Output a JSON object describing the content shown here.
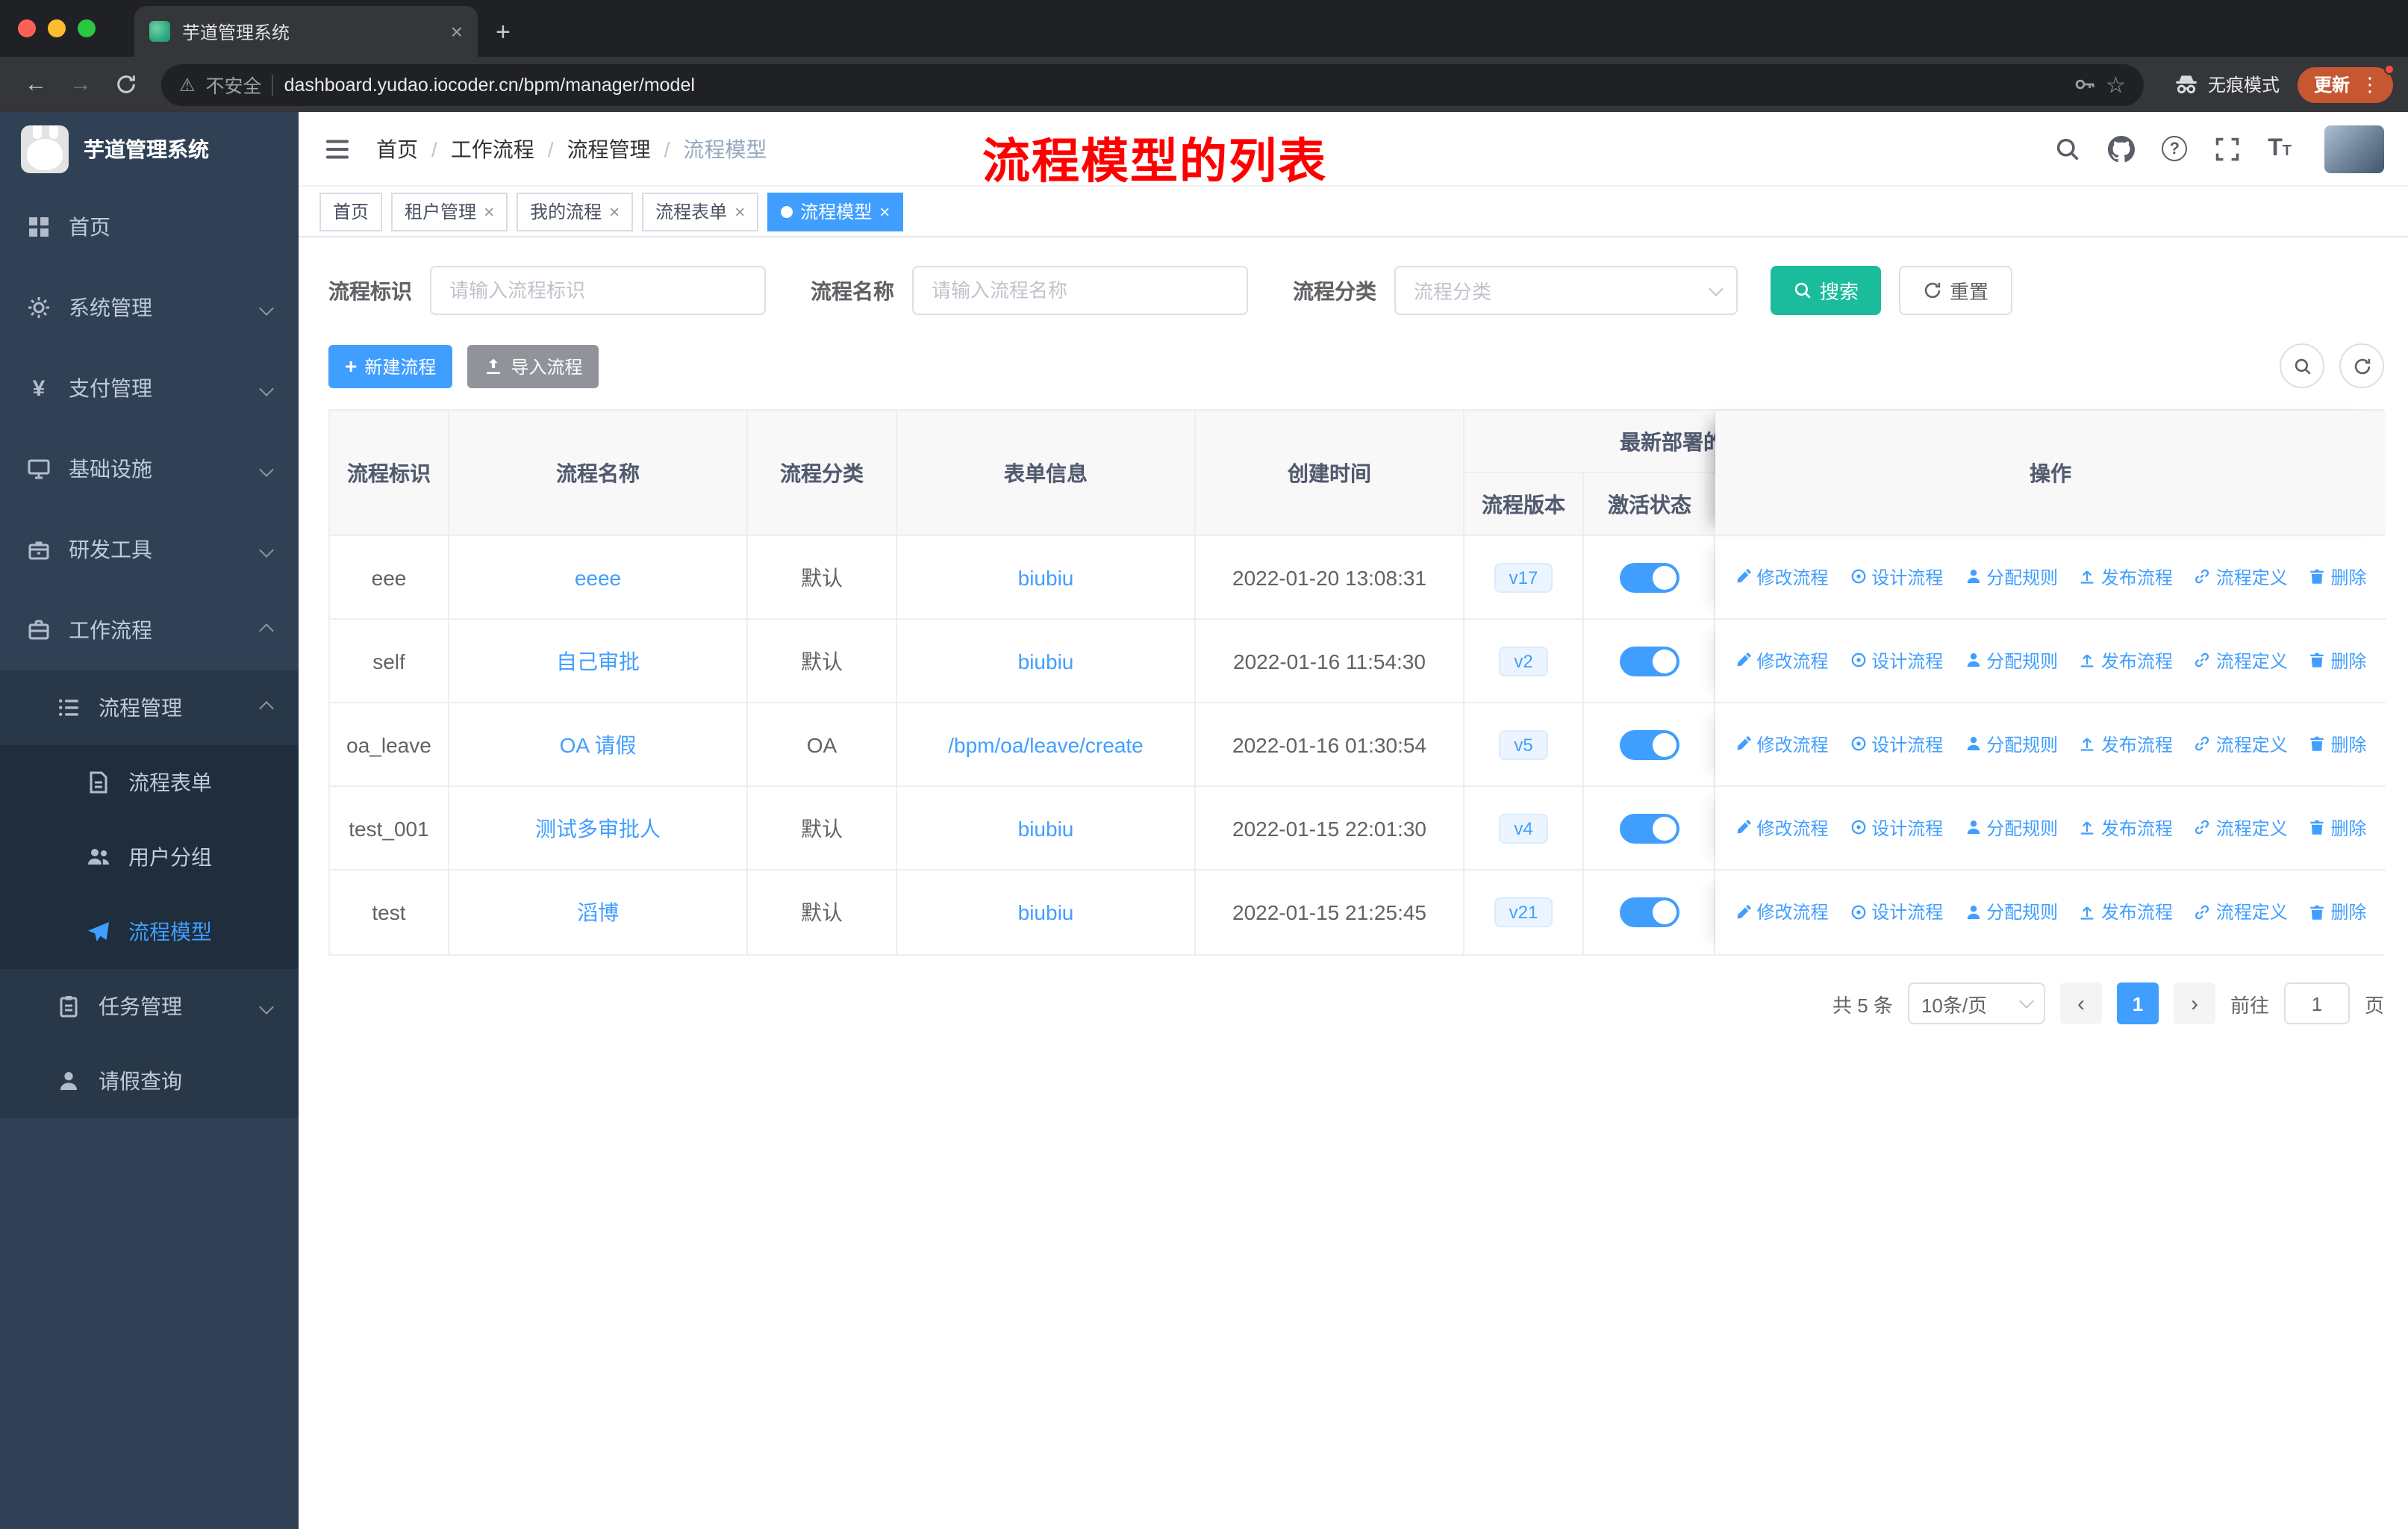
{
  "colors": {
    "primary": "#409EFF",
    "search_button": "#1ABC9C",
    "sidebar_bg": "#304156",
    "active_tag": "#409EFF",
    "annotation_red": "#FF0000",
    "toggle_on": "#409EFF",
    "update_pill": "#C65730"
  },
  "glyphs": {
    "back_arrow": "←",
    "forward_arrow": "→",
    "warning": "⚠",
    "star": "☆",
    "menu_dots": "⋮",
    "close": "×",
    "new_tab": "+",
    "plus": "+",
    "yen": "¥",
    "question": "?",
    "font_size_big": "T",
    "font_size_small": "T",
    "slash": "/",
    "prev": "‹",
    "next": "›"
  },
  "browser": {
    "tab_title": "芋道管理系统",
    "security_label": "不安全",
    "url": "dashboard.yudao.iocoder.cn/bpm/manager/model",
    "incognito_label": "无痕模式",
    "update_label": "更新"
  },
  "sidebar": {
    "logo_title": "芋道管理系统",
    "items": {
      "home": "首页",
      "system": "系统管理",
      "payment": "支付管理",
      "infrastructure": "基础设施",
      "devtools": "研发工具",
      "workflow": "工作流程",
      "process_mgmt": "流程管理",
      "process_form": "流程表单",
      "user_group": "用户分组",
      "process_model": "流程模型",
      "task_mgmt": "任务管理",
      "leave_query": "请假查询"
    }
  },
  "header": {
    "breadcrumb": [
      "首页",
      "工作流程",
      "流程管理",
      "流程模型"
    ],
    "annotation": "流程模型的列表"
  },
  "tags": [
    {
      "label": "首页",
      "closable": false,
      "active": false
    },
    {
      "label": "租户管理",
      "closable": true,
      "active": false
    },
    {
      "label": "我的流程",
      "closable": true,
      "active": false
    },
    {
      "label": "流程表单",
      "closable": true,
      "active": false
    },
    {
      "label": "流程模型",
      "closable": true,
      "active": true
    }
  ],
  "filters": {
    "id_label": "流程标识",
    "id_placeholder": "请输入流程标识",
    "name_label": "流程名称",
    "name_placeholder": "请输入流程名称",
    "category_label": "流程分类",
    "category_placeholder": "流程分类",
    "search_button": "搜索",
    "reset_button": "重置"
  },
  "toolbar": {
    "create_button": "新建流程",
    "import_button": "导入流程"
  },
  "table": {
    "headers": {
      "id": "流程标识",
      "name": "流程名称",
      "category": "流程分类",
      "form": "表单信息",
      "created": "创建时间",
      "deploy_group": "最新部署的",
      "version": "流程版本",
      "active": "激活状态",
      "ops": "操作"
    },
    "actions": [
      {
        "label": "修改流程",
        "icon": "edit-icon"
      },
      {
        "label": "设计流程",
        "icon": "design-icon"
      },
      {
        "label": "分配规则",
        "icon": "assign-user-icon"
      },
      {
        "label": "发布流程",
        "icon": "publish-icon"
      },
      {
        "label": "流程定义",
        "icon": "definition-link-icon"
      },
      {
        "label": "删除",
        "icon": "delete-icon"
      }
    ],
    "rows": [
      {
        "id": "eee",
        "name": "eeee",
        "category": "默认",
        "form": "biubiu",
        "created": "2022-01-20 13:08:31",
        "version": "v17",
        "active": true
      },
      {
        "id": "self",
        "name": "自己审批",
        "category": "默认",
        "form": "biubiu",
        "created": "2022-01-16 11:54:30",
        "version": "v2",
        "active": true
      },
      {
        "id": "oa_leave",
        "name": "OA 请假",
        "category": "OA",
        "form": "/bpm/oa/leave/create",
        "created": "2022-01-16 01:30:54",
        "version": "v5",
        "active": true
      },
      {
        "id": "test_001",
        "name": "测试多审批人",
        "category": "默认",
        "form": "biubiu",
        "created": "2022-01-15 22:01:30",
        "version": "v4",
        "active": true
      },
      {
        "id": "test",
        "name": "滔博",
        "category": "默认",
        "form": "biubiu",
        "created": "2022-01-15 21:25:45",
        "version": "v21",
        "active": true
      }
    ]
  },
  "pagination": {
    "total": "共 5 条",
    "page_size": "10条/页",
    "current": "1",
    "goto_label": "前往",
    "page_unit": "页",
    "goto_value": "1"
  }
}
